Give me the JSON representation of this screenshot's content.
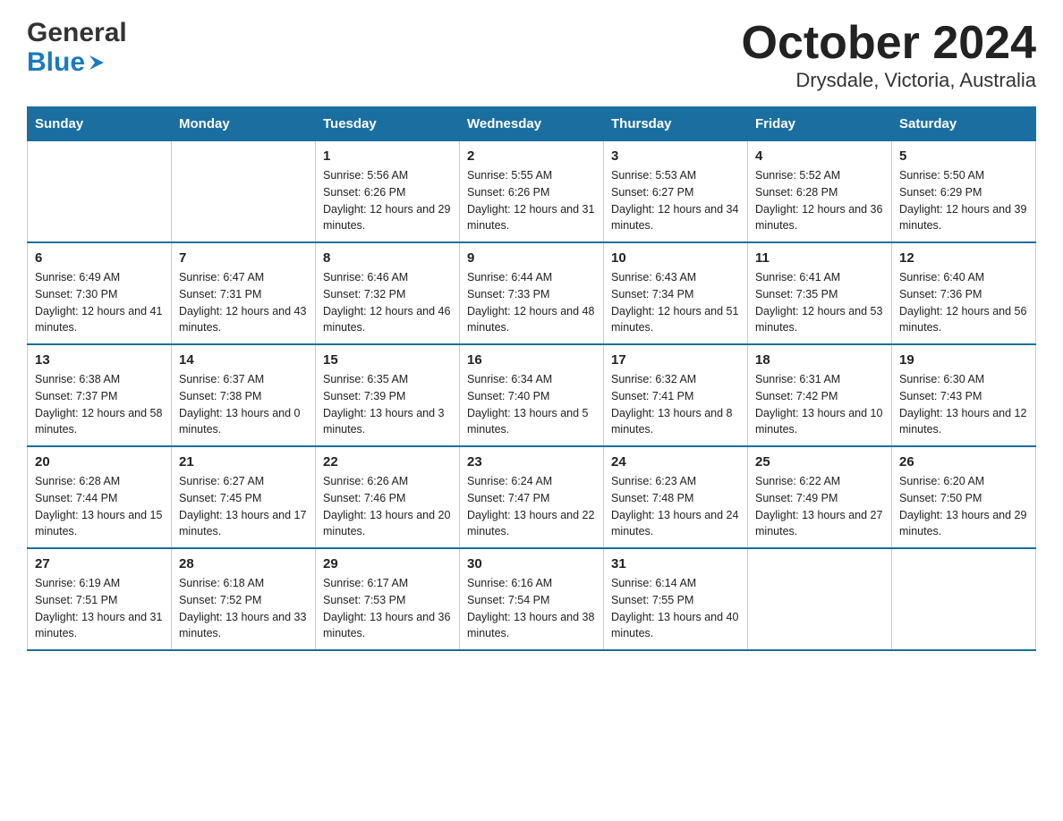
{
  "header": {
    "logo_line1": "General",
    "logo_line2": "Blue",
    "title": "October 2024",
    "subtitle": "Drysdale, Victoria, Australia"
  },
  "weekdays": [
    "Sunday",
    "Monday",
    "Tuesday",
    "Wednesday",
    "Thursday",
    "Friday",
    "Saturday"
  ],
  "weeks": [
    [
      {
        "day": "",
        "sunrise": "",
        "sunset": "",
        "daylight": ""
      },
      {
        "day": "",
        "sunrise": "",
        "sunset": "",
        "daylight": ""
      },
      {
        "day": "1",
        "sunrise": "Sunrise: 5:56 AM",
        "sunset": "Sunset: 6:26 PM",
        "daylight": "Daylight: 12 hours and 29 minutes."
      },
      {
        "day": "2",
        "sunrise": "Sunrise: 5:55 AM",
        "sunset": "Sunset: 6:26 PM",
        "daylight": "Daylight: 12 hours and 31 minutes."
      },
      {
        "day": "3",
        "sunrise": "Sunrise: 5:53 AM",
        "sunset": "Sunset: 6:27 PM",
        "daylight": "Daylight: 12 hours and 34 minutes."
      },
      {
        "day": "4",
        "sunrise": "Sunrise: 5:52 AM",
        "sunset": "Sunset: 6:28 PM",
        "daylight": "Daylight: 12 hours and 36 minutes."
      },
      {
        "day": "5",
        "sunrise": "Sunrise: 5:50 AM",
        "sunset": "Sunset: 6:29 PM",
        "daylight": "Daylight: 12 hours and 39 minutes."
      }
    ],
    [
      {
        "day": "6",
        "sunrise": "Sunrise: 6:49 AM",
        "sunset": "Sunset: 7:30 PM",
        "daylight": "Daylight: 12 hours and 41 minutes."
      },
      {
        "day": "7",
        "sunrise": "Sunrise: 6:47 AM",
        "sunset": "Sunset: 7:31 PM",
        "daylight": "Daylight: 12 hours and 43 minutes."
      },
      {
        "day": "8",
        "sunrise": "Sunrise: 6:46 AM",
        "sunset": "Sunset: 7:32 PM",
        "daylight": "Daylight: 12 hours and 46 minutes."
      },
      {
        "day": "9",
        "sunrise": "Sunrise: 6:44 AM",
        "sunset": "Sunset: 7:33 PM",
        "daylight": "Daylight: 12 hours and 48 minutes."
      },
      {
        "day": "10",
        "sunrise": "Sunrise: 6:43 AM",
        "sunset": "Sunset: 7:34 PM",
        "daylight": "Daylight: 12 hours and 51 minutes."
      },
      {
        "day": "11",
        "sunrise": "Sunrise: 6:41 AM",
        "sunset": "Sunset: 7:35 PM",
        "daylight": "Daylight: 12 hours and 53 minutes."
      },
      {
        "day": "12",
        "sunrise": "Sunrise: 6:40 AM",
        "sunset": "Sunset: 7:36 PM",
        "daylight": "Daylight: 12 hours and 56 minutes."
      }
    ],
    [
      {
        "day": "13",
        "sunrise": "Sunrise: 6:38 AM",
        "sunset": "Sunset: 7:37 PM",
        "daylight": "Daylight: 12 hours and 58 minutes."
      },
      {
        "day": "14",
        "sunrise": "Sunrise: 6:37 AM",
        "sunset": "Sunset: 7:38 PM",
        "daylight": "Daylight: 13 hours and 0 minutes."
      },
      {
        "day": "15",
        "sunrise": "Sunrise: 6:35 AM",
        "sunset": "Sunset: 7:39 PM",
        "daylight": "Daylight: 13 hours and 3 minutes."
      },
      {
        "day": "16",
        "sunrise": "Sunrise: 6:34 AM",
        "sunset": "Sunset: 7:40 PM",
        "daylight": "Daylight: 13 hours and 5 minutes."
      },
      {
        "day": "17",
        "sunrise": "Sunrise: 6:32 AM",
        "sunset": "Sunset: 7:41 PM",
        "daylight": "Daylight: 13 hours and 8 minutes."
      },
      {
        "day": "18",
        "sunrise": "Sunrise: 6:31 AM",
        "sunset": "Sunset: 7:42 PM",
        "daylight": "Daylight: 13 hours and 10 minutes."
      },
      {
        "day": "19",
        "sunrise": "Sunrise: 6:30 AM",
        "sunset": "Sunset: 7:43 PM",
        "daylight": "Daylight: 13 hours and 12 minutes."
      }
    ],
    [
      {
        "day": "20",
        "sunrise": "Sunrise: 6:28 AM",
        "sunset": "Sunset: 7:44 PM",
        "daylight": "Daylight: 13 hours and 15 minutes."
      },
      {
        "day": "21",
        "sunrise": "Sunrise: 6:27 AM",
        "sunset": "Sunset: 7:45 PM",
        "daylight": "Daylight: 13 hours and 17 minutes."
      },
      {
        "day": "22",
        "sunrise": "Sunrise: 6:26 AM",
        "sunset": "Sunset: 7:46 PM",
        "daylight": "Daylight: 13 hours and 20 minutes."
      },
      {
        "day": "23",
        "sunrise": "Sunrise: 6:24 AM",
        "sunset": "Sunset: 7:47 PM",
        "daylight": "Daylight: 13 hours and 22 minutes."
      },
      {
        "day": "24",
        "sunrise": "Sunrise: 6:23 AM",
        "sunset": "Sunset: 7:48 PM",
        "daylight": "Daylight: 13 hours and 24 minutes."
      },
      {
        "day": "25",
        "sunrise": "Sunrise: 6:22 AM",
        "sunset": "Sunset: 7:49 PM",
        "daylight": "Daylight: 13 hours and 27 minutes."
      },
      {
        "day": "26",
        "sunrise": "Sunrise: 6:20 AM",
        "sunset": "Sunset: 7:50 PM",
        "daylight": "Daylight: 13 hours and 29 minutes."
      }
    ],
    [
      {
        "day": "27",
        "sunrise": "Sunrise: 6:19 AM",
        "sunset": "Sunset: 7:51 PM",
        "daylight": "Daylight: 13 hours and 31 minutes."
      },
      {
        "day": "28",
        "sunrise": "Sunrise: 6:18 AM",
        "sunset": "Sunset: 7:52 PM",
        "daylight": "Daylight: 13 hours and 33 minutes."
      },
      {
        "day": "29",
        "sunrise": "Sunrise: 6:17 AM",
        "sunset": "Sunset: 7:53 PM",
        "daylight": "Daylight: 13 hours and 36 minutes."
      },
      {
        "day": "30",
        "sunrise": "Sunrise: 6:16 AM",
        "sunset": "Sunset: 7:54 PM",
        "daylight": "Daylight: 13 hours and 38 minutes."
      },
      {
        "day": "31",
        "sunrise": "Sunrise: 6:14 AM",
        "sunset": "Sunset: 7:55 PM",
        "daylight": "Daylight: 13 hours and 40 minutes."
      },
      {
        "day": "",
        "sunrise": "",
        "sunset": "",
        "daylight": ""
      },
      {
        "day": "",
        "sunrise": "",
        "sunset": "",
        "daylight": ""
      }
    ]
  ]
}
